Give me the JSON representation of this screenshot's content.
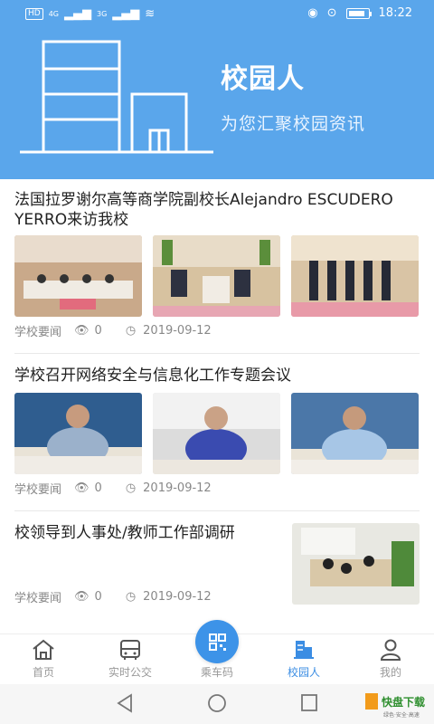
{
  "status_bar": {
    "hd": "HD",
    "signal1": "4G",
    "signal2": "3G",
    "time": "18:22",
    "battery_level": 0.85
  },
  "hero": {
    "title": "校园人",
    "subtitle": "为您汇聚校园资讯"
  },
  "articles": [
    {
      "headline": "法国拉罗谢尔高等商学院副校长Alejandro ESCUDERO YERRO来访我校",
      "category": "学校要闻",
      "views": "0",
      "date": "2019-09-12",
      "images": [
        "meeting-room-photo",
        "handshake-photo",
        "group-photo"
      ]
    },
    {
      "headline": "学校召开网络安全与信息化工作专题会议",
      "category": "学校要闻",
      "views": "0",
      "date": "2019-09-12",
      "images": [
        "speaker-photo",
        "speaker-photo",
        "speaker-photo"
      ]
    },
    {
      "headline": "校领导到人事处/教师工作部调研",
      "category": "学校要闻",
      "views": "0",
      "date": "2019-09-12",
      "images": [
        "office-meeting-photo"
      ]
    }
  ],
  "tabbar": {
    "items": [
      {
        "label": "首页",
        "icon": "home-icon"
      },
      {
        "label": "实时公交",
        "icon": "bus-icon"
      },
      {
        "label": "乘车码",
        "icon": "qr-code-icon"
      },
      {
        "label": "校园人",
        "icon": "building-icon"
      },
      {
        "label": "我的",
        "icon": "user-icon"
      }
    ],
    "active": "校园人"
  },
  "watermark": {
    "brand": "快盘下载",
    "tagline": "绿色·安全·高速"
  },
  "colors": {
    "accent": "#5aa6eb",
    "active_tab": "#3b8de3"
  }
}
